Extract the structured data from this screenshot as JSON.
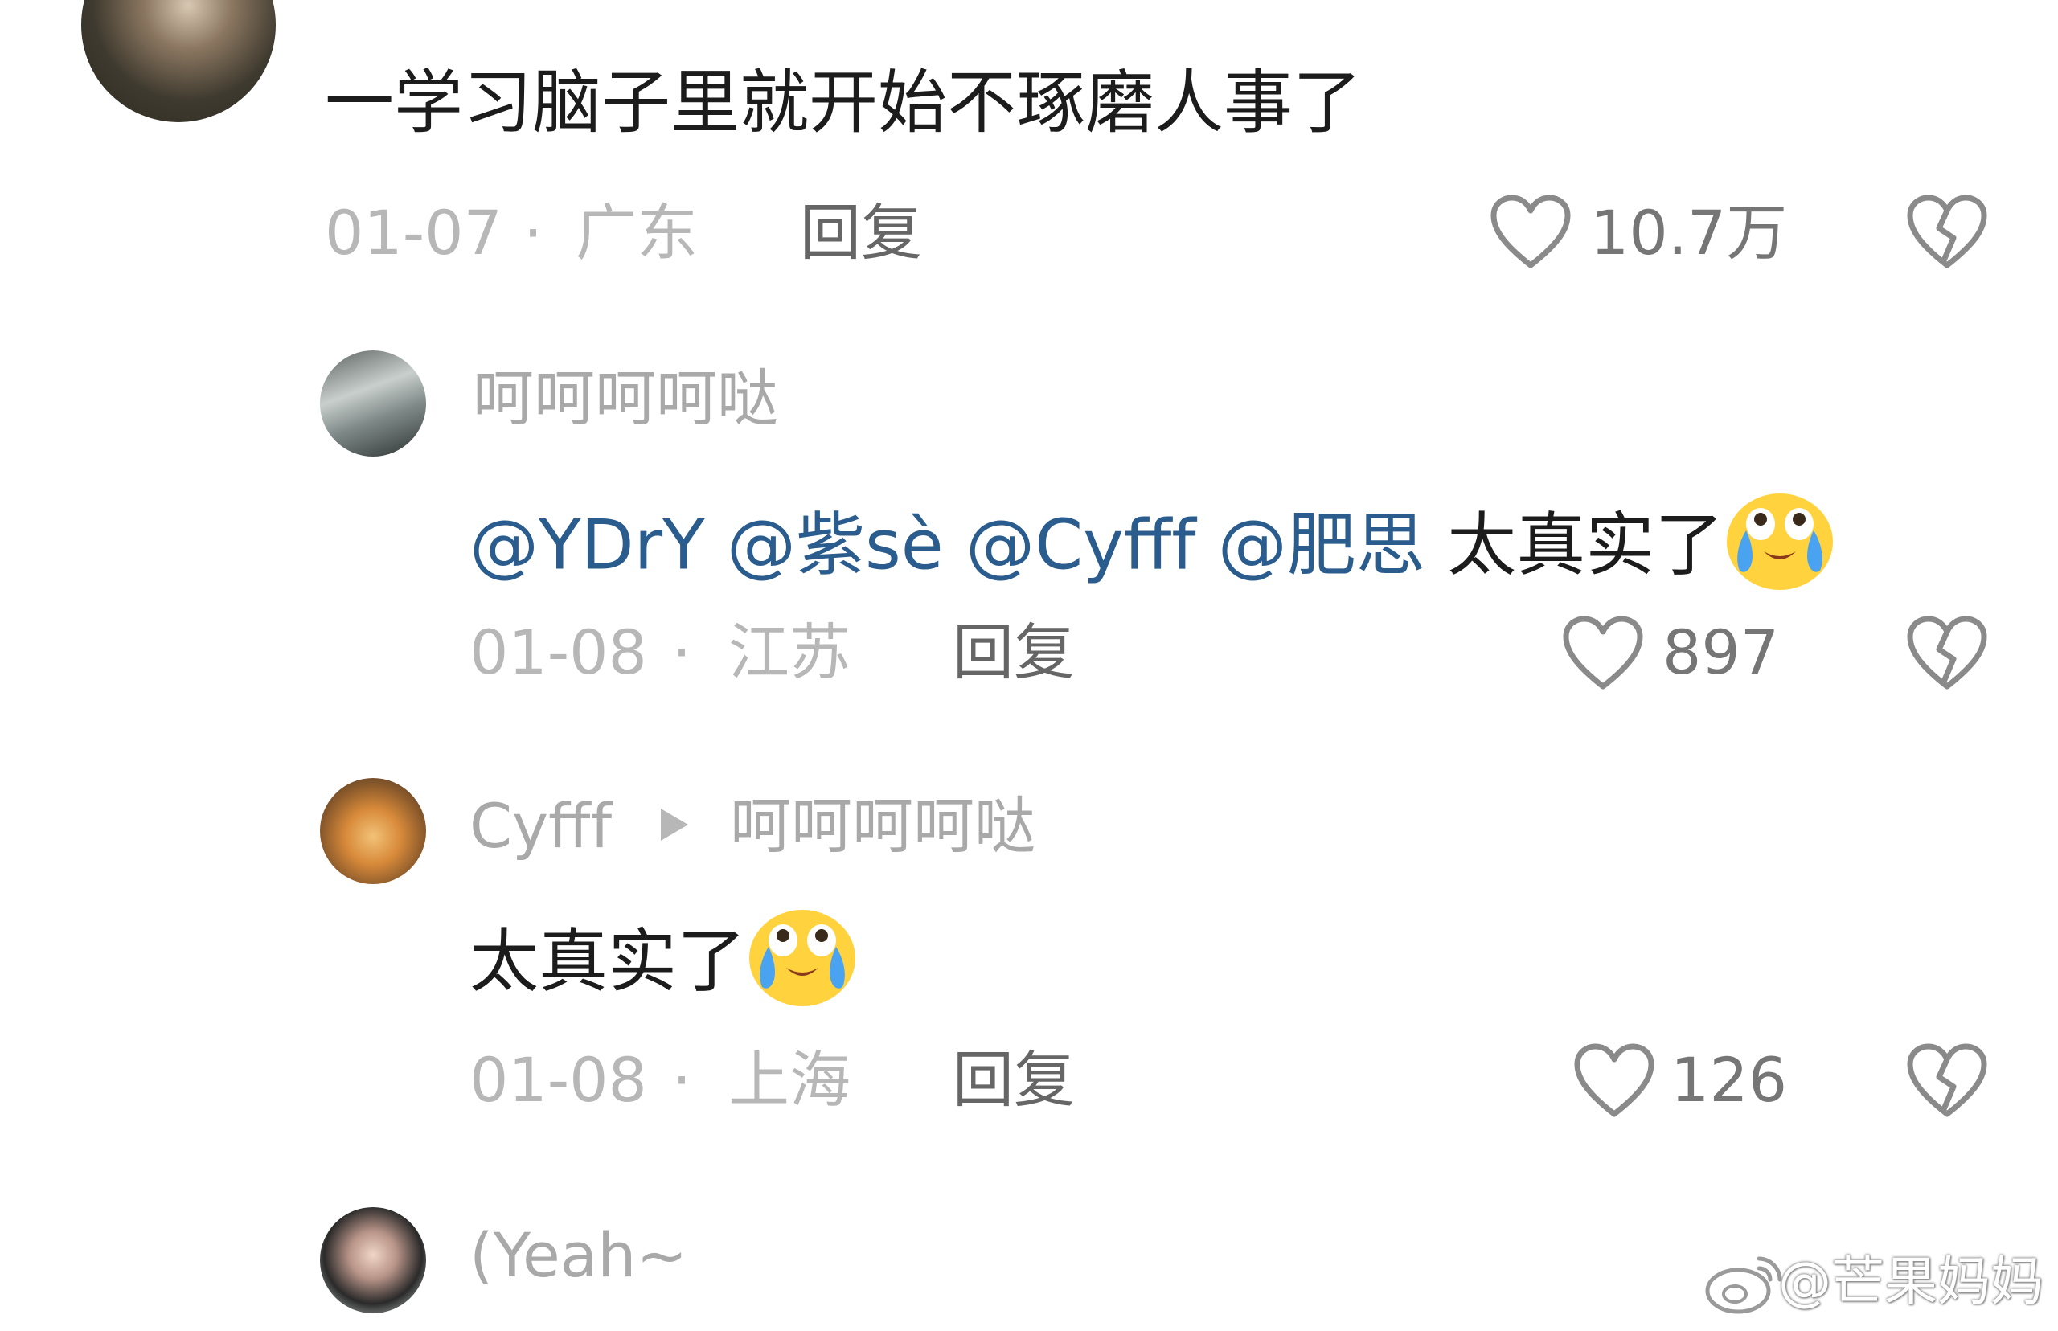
{
  "comments": [
    {
      "username": "",
      "text": "一学习脑子里就开始不琢磨人事了",
      "date": "01-07",
      "location": "广东",
      "reply_label": "回复",
      "likes": "10.7万"
    },
    {
      "username": "呵呵呵呵哒",
      "mentions": [
        "@YDrY",
        "@紫sè",
        "@Cyfff",
        "@肥思"
      ],
      "text": "太真实了",
      "date": "01-08",
      "location": "江苏",
      "reply_label": "回复",
      "likes": "897"
    },
    {
      "username": "Cyfff",
      "reply_to": "呵呵呵呵哒",
      "text": "太真实了",
      "date": "01-08",
      "location": "上海",
      "reply_label": "回复",
      "likes": "126"
    },
    {
      "username": "(Yeah~"
    }
  ],
  "meta_separator": "·",
  "watermark": "@芒果妈妈",
  "icons": {
    "like": "heart-outline-icon",
    "dislike": "broken-heart-icon",
    "emoji": "crying-laughing-emoji",
    "reply_arrow": "play-triangle-icon",
    "watermark_logo": "weibo-logo-icon"
  },
  "colors": {
    "mention": "#2a5c8e",
    "username": "#a9a9a9",
    "meta": "#b7b7b7"
  }
}
